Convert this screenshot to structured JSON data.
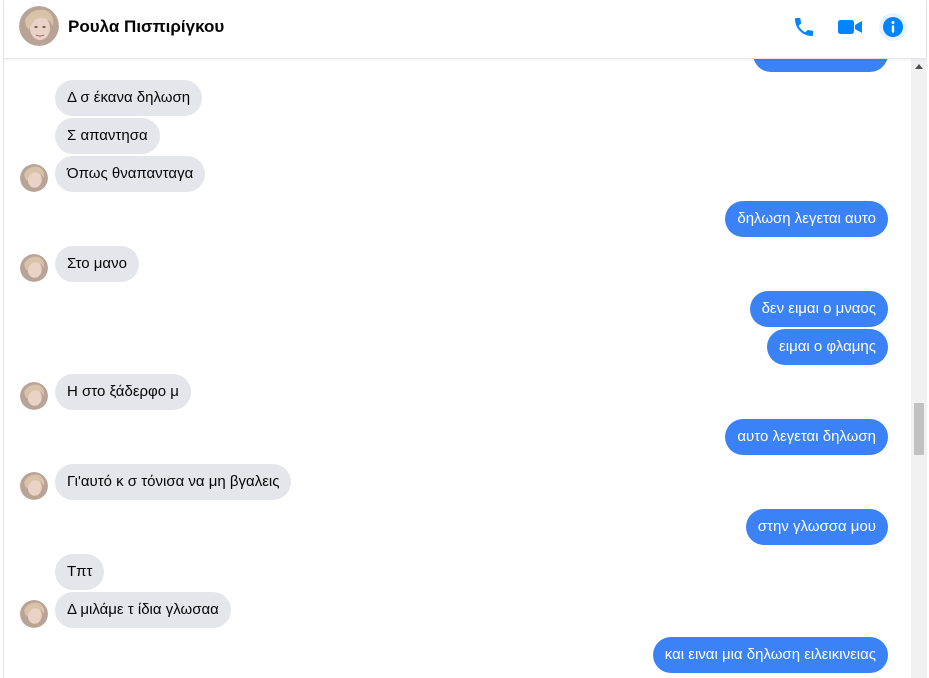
{
  "header": {
    "contact_name": "Ρουλα Πισπιρίγκου",
    "icons": {
      "phone": "phone-icon",
      "video": "video-camera-icon",
      "info": "info-icon"
    },
    "accent_color": "#0084ff"
  },
  "messages": [
    {
      "side": "in",
      "text": "Δ σ έκανα δηλωση"
    },
    {
      "side": "in",
      "text": "Σ απαντησα"
    },
    {
      "side": "in",
      "text": "Όπως θναπανταγα"
    },
    {
      "side": "out",
      "text": "δηλωση λεγεται αυτο"
    },
    {
      "side": "in",
      "text": "Στο μανο"
    },
    {
      "side": "out",
      "text": "δεν ειμαι ο μναος"
    },
    {
      "side": "out",
      "text": "ειμαι ο φλαμης"
    },
    {
      "side": "in",
      "text": "Η στο ξάδερφο μ"
    },
    {
      "side": "out",
      "text": "αυτο λεγεται δηλωση"
    },
    {
      "side": "in",
      "text": "Γι'αυτό κ σ τόνισα να μη βγαλεις"
    },
    {
      "side": "out",
      "text": "στην γλωσσα μου"
    },
    {
      "side": "in",
      "text": "Τπτ"
    },
    {
      "side": "in",
      "text": "Δ μιλάμε τ ίδια γλωσαα"
    },
    {
      "side": "out",
      "text": "και ειναι μια δηλωση ειλεικινειας"
    }
  ],
  "colors": {
    "incoming_bubble": "#e4e6eb",
    "outgoing_bubble": "#3b82f6"
  }
}
